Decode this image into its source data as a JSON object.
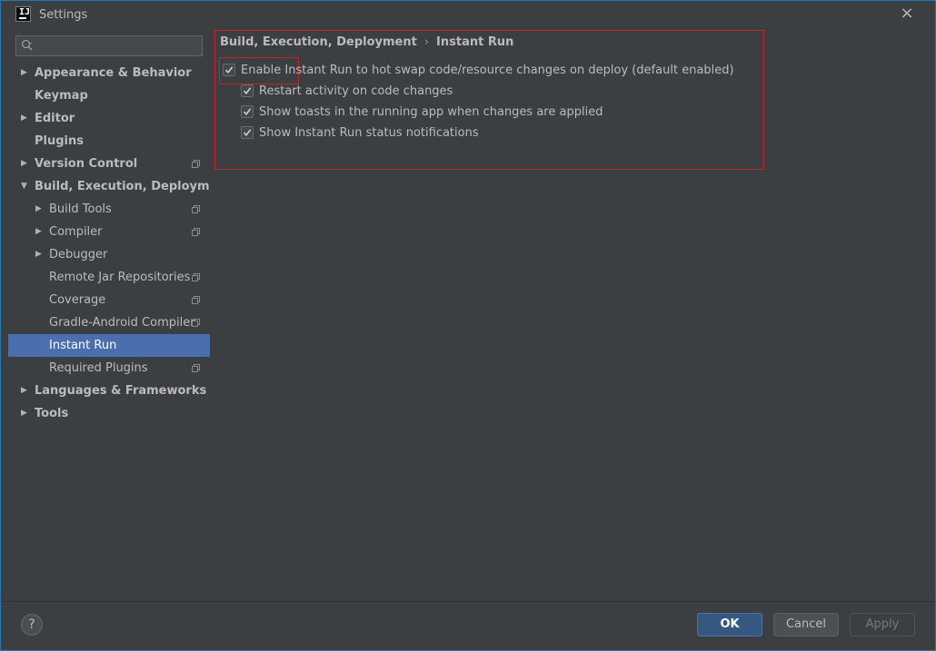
{
  "window": {
    "title": "Settings"
  },
  "sidebar": {
    "search": {
      "value": "",
      "placeholder": ""
    },
    "items": [
      {
        "label": "Appearance & Behavior",
        "level": 0,
        "bold": true,
        "arrow": "right"
      },
      {
        "label": "Keymap",
        "level": 0,
        "bold": true,
        "arrow": ""
      },
      {
        "label": "Editor",
        "level": 0,
        "bold": true,
        "arrow": "right"
      },
      {
        "label": "Plugins",
        "level": 0,
        "bold": true,
        "arrow": ""
      },
      {
        "label": "Version Control",
        "level": 0,
        "bold": true,
        "arrow": "right",
        "scope": true
      },
      {
        "label": "Build, Execution, Deployment",
        "level": 0,
        "bold": true,
        "arrow": "down"
      },
      {
        "label": "Build Tools",
        "level": 1,
        "bold": false,
        "arrow": "right",
        "scope": true
      },
      {
        "label": "Compiler",
        "level": 1,
        "bold": false,
        "arrow": "right",
        "scope": true
      },
      {
        "label": "Debugger",
        "level": 1,
        "bold": false,
        "arrow": "right"
      },
      {
        "label": "Remote Jar Repositories",
        "level": 1,
        "bold": false,
        "arrow": "",
        "scope": true
      },
      {
        "label": "Coverage",
        "level": 1,
        "bold": false,
        "arrow": "",
        "scope": true
      },
      {
        "label": "Gradle-Android Compiler",
        "level": 1,
        "bold": false,
        "arrow": "",
        "scope": true
      },
      {
        "label": "Instant Run",
        "level": 1,
        "bold": false,
        "arrow": "",
        "selected": true
      },
      {
        "label": "Required Plugins",
        "level": 1,
        "bold": false,
        "arrow": "",
        "scope": true
      },
      {
        "label": "Languages & Frameworks",
        "level": 0,
        "bold": true,
        "arrow": "right"
      },
      {
        "label": "Tools",
        "level": 0,
        "bold": true,
        "arrow": "right"
      }
    ]
  },
  "content": {
    "breadcrumb": {
      "parent": "Build, Execution, Deployment",
      "separator": "›",
      "current": "Instant Run"
    },
    "options": [
      {
        "label": "Enable Instant Run to hot swap code/resource changes on deploy (default enabled)",
        "checked": true,
        "indent": 0
      },
      {
        "label": "Restart activity on code changes",
        "checked": true,
        "indent": 1
      },
      {
        "label": "Show toasts in the running app when changes are applied",
        "checked": true,
        "indent": 1
      },
      {
        "label": "Show Instant Run status notifications",
        "checked": true,
        "indent": 1
      }
    ]
  },
  "footer": {
    "help_label": "?",
    "ok_label": "OK",
    "cancel_label": "Cancel",
    "apply_label": "Apply"
  },
  "colors": {
    "background": "#3c3f41",
    "selection": "#4b6eaf",
    "highlight_border": "#c0272d",
    "ok_button": "#365880",
    "text": "#bbbbbb"
  },
  "icons": {
    "app": "intellij-icon",
    "close": "close-icon",
    "search": "search-icon",
    "tree_collapsed": "triangle-right-icon",
    "tree_expanded": "triangle-down-icon",
    "scope": "project-scope-icon",
    "check": "checkmark-icon"
  }
}
